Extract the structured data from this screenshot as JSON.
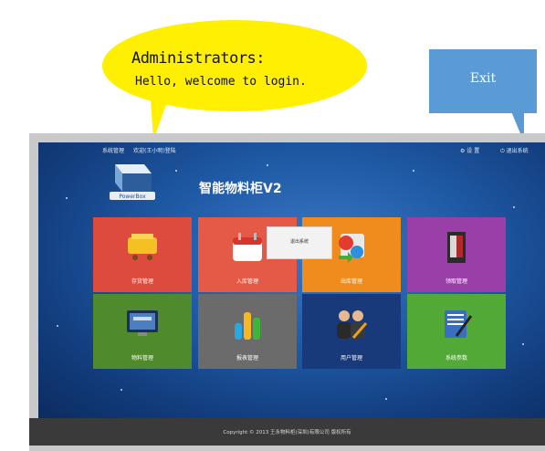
{
  "callouts": {
    "admin_line1": "Administrators:",
    "admin_line2": "Hello, welcome to login.",
    "exit_label": "Exit"
  },
  "topbar": {
    "left_item_1": "系统管理",
    "left_item_2": "欢迎(王小明)登陆",
    "right_item_1": "设 置",
    "right_item_2": "退出系统"
  },
  "app": {
    "logo_text": "PowerBox",
    "title": "智能物料柜V2"
  },
  "tiles": [
    {
      "label": "存货管理",
      "color": "#dc4b3e",
      "icon": "cart-icon"
    },
    {
      "label": "入库管理",
      "color": "#e45a46",
      "icon": "calendar-icon"
    },
    {
      "label": "出库管理",
      "color": "#f08c1e",
      "icon": "exchange-icon"
    },
    {
      "label": "领取管理",
      "color": "#9b3fa8",
      "icon": "cabinet-icon"
    },
    {
      "label": "物料管理",
      "color": "#4f8a2d",
      "icon": "monitor-icon"
    },
    {
      "label": "报表管理",
      "color": "#6b6b6b",
      "icon": "bar-chart-icon"
    },
    {
      "label": "用户管理",
      "color": "#183a7a",
      "icon": "users-icon"
    },
    {
      "label": "系统参数",
      "color": "#53a935",
      "icon": "notebook-icon"
    }
  ],
  "center_button": {
    "label": "退出系统"
  },
  "footer": {
    "text": "Copyright © 2013 王永物料柜(深圳)有限公司 版权所有"
  }
}
